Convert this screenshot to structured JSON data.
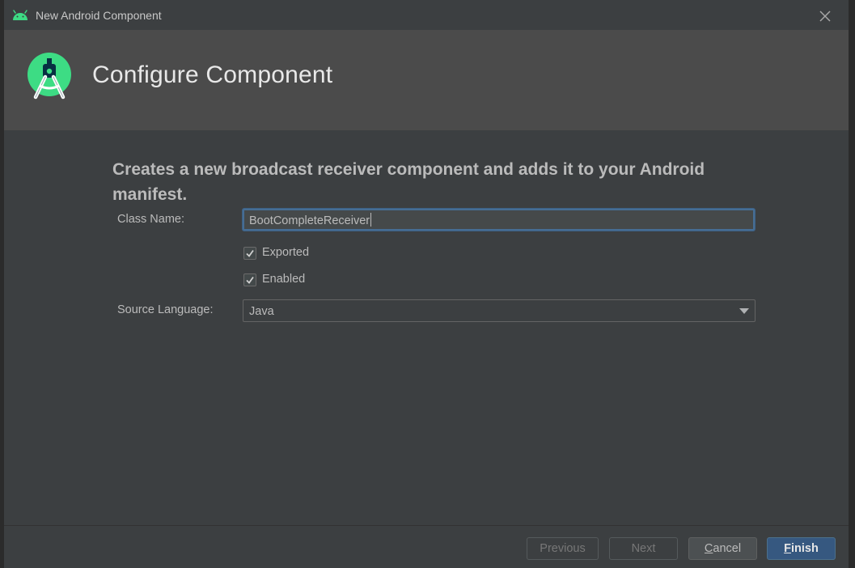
{
  "window": {
    "title": "New Android Component"
  },
  "header": {
    "title": "Configure Component"
  },
  "form": {
    "description": "Creates a new broadcast receiver component and adds it to your Android manifest.",
    "class_name_label": "Class Name:",
    "class_name_value": "BootCompleteReceiver",
    "exported_label": "Exported",
    "exported_checked": true,
    "enabled_label": "Enabled",
    "enabled_checked": true,
    "source_language_label": "Source Language:",
    "source_language_value": "Java"
  },
  "footer": {
    "previous_label": "Previous",
    "next_label": "Next",
    "cancel_mnemonic": "C",
    "cancel_rest": "ancel",
    "finish_mnemonic": "F",
    "finish_rest": "inish"
  },
  "colors": {
    "android_green": "#3ddc84",
    "primary_button": "#365880",
    "focus_border": "#466d94"
  },
  "icons": {
    "window_icon": "android-icon",
    "header_logo": "android-studio-logo",
    "close": "close-icon",
    "dropdown": "chevron-down-icon",
    "check": "check-icon"
  }
}
